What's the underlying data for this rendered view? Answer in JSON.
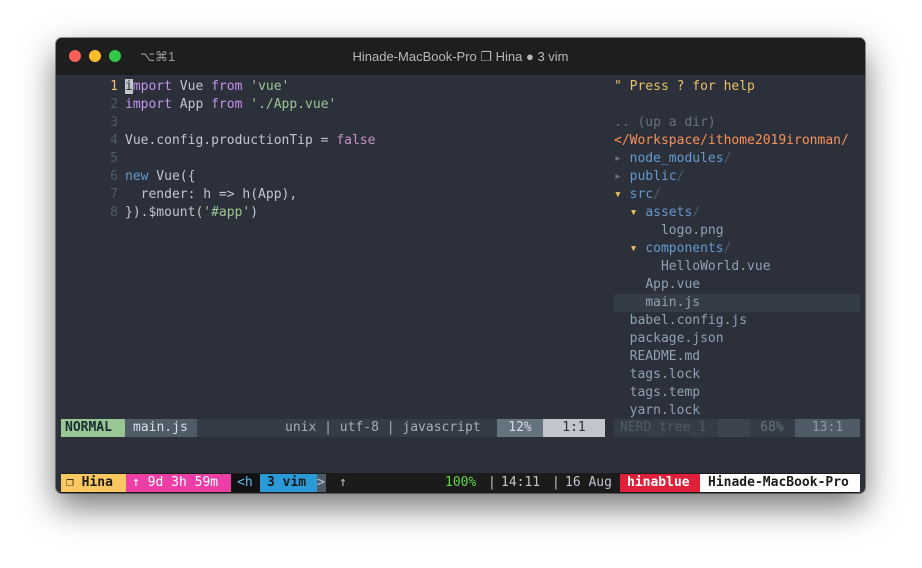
{
  "titlebar": {
    "shortcut": "⌥⌘1",
    "title": "Hinade-MacBook-Pro ❐ Hina ● 3 vim"
  },
  "editor": {
    "lines": [
      {
        "num": "1",
        "current": true
      },
      {
        "num": "2"
      },
      {
        "num": "3"
      },
      {
        "num": "4"
      },
      {
        "num": "5"
      },
      {
        "num": "6"
      },
      {
        "num": "7"
      },
      {
        "num": "8"
      }
    ],
    "code": {
      "l1_cursor": "i",
      "l1_kw": "mport",
      "l1_mid": " Vue ",
      "l1_from": "from",
      "l1_str": "'vue'",
      "l2_kw": "import",
      "l2_mid": " App ",
      "l2_from": "from",
      "l2_str": "'./App.vue'",
      "l4_text": "Vue.config.productionTip = ",
      "l4_bool": "false",
      "l6_new": "new",
      "l6_text": " Vue({",
      "l7_text": "  render: h => h(App),",
      "l8_text": "}).$mount(",
      "l8_str": "'#app'",
      "l8_end": ")"
    }
  },
  "nerdtree": {
    "help": "\" Press ? for help",
    "up": ".. (up a dir)",
    "root": "</Workspace/ithome2019ironman/",
    "items": [
      {
        "arrow": "▸",
        "name": "node_modules",
        "slash": "/"
      },
      {
        "arrow": "▸",
        "name": "public",
        "slash": "/"
      },
      {
        "arrow": "▾",
        "name": "src",
        "slash": "/"
      },
      {
        "arrow": "▾",
        "name": "assets",
        "slash": "/"
      },
      {
        "name": "logo.png"
      },
      {
        "arrow": "▾",
        "name": "components",
        "slash": "/"
      },
      {
        "name": "HelloWorld.vue"
      },
      {
        "name": "App.vue"
      },
      {
        "name": "main.js"
      },
      {
        "name": "babel.config.js"
      },
      {
        "name": "package.json"
      },
      {
        "name": "README.md"
      },
      {
        "name": "tags.lock"
      },
      {
        "name": "tags.temp"
      },
      {
        "name": "yarn.lock"
      }
    ]
  },
  "statusline": {
    "mode": "NORMAL",
    "file": "main.js",
    "format": "unix | utf-8 | javascript",
    "percent": "12%",
    "position": "1:1",
    "nt_name": "NERD_tree_1",
    "nt_percent": "68%",
    "nt_position": "13:1"
  },
  "tmux": {
    "session": "❐ Hina",
    "uptime": "↑ 9d 3h 59m",
    "prefix": "<h",
    "window": "3 vim",
    "win_sep": ">",
    "battery_arrow": "↑",
    "battery_percent": "100%",
    "time": "14:11",
    "date": "16 Aug",
    "user": "hinablue",
    "host": "Hinade-MacBook-Pro",
    "sep1": "|",
    "sep2": "|"
  },
  "colors": {
    "editor_bg": "#2b303b",
    "mode_bg": "#99c794",
    "tmux_session_bg": "#fac863",
    "tmux_uptime_bg": "#ec3fa6",
    "tmux_window_bg": "#2b9bd8",
    "tmux_user_bg": "#e0203a"
  }
}
